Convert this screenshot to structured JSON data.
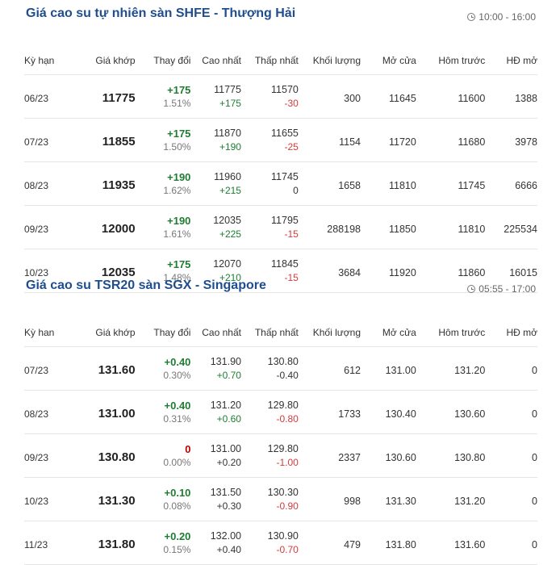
{
  "sections": [
    {
      "title": "Giá cao su tự nhiên sàn SHFE - Thượng Hải",
      "time": "10:00 - 16:00",
      "headers": [
        "Kỳ hạn",
        "Giá khớp",
        "Thay đổi",
        "Cao nhất",
        "Thấp nhất",
        "Khối lượng",
        "Mở cửa",
        "Hôm trước",
        "HĐ mở"
      ],
      "rows": [
        {
          "term": "06/23",
          "price": "11775",
          "change": "+175",
          "pct": "1.51%",
          "change_dir": "up",
          "high": "11775",
          "high_chg": "+175",
          "high_dir": "up",
          "low": "11570",
          "low_chg": "-30",
          "low_dir": "down",
          "volume": "300",
          "open": "11645",
          "prev": "11600",
          "oi": "1388"
        },
        {
          "term": "07/23",
          "price": "11855",
          "change": "+175",
          "pct": "1.50%",
          "change_dir": "up",
          "high": "11870",
          "high_chg": "+190",
          "high_dir": "up",
          "low": "11655",
          "low_chg": "-25",
          "low_dir": "down",
          "volume": "1154",
          "open": "11720",
          "prev": "11680",
          "oi": "3978"
        },
        {
          "term": "08/23",
          "price": "11935",
          "change": "+190",
          "pct": "1.62%",
          "change_dir": "up",
          "high": "11960",
          "high_chg": "+215",
          "high_dir": "up",
          "low": "11745",
          "low_chg": "0",
          "low_dir": "flat",
          "volume": "1658",
          "open": "11810",
          "prev": "11745",
          "oi": "6666"
        },
        {
          "term": "09/23",
          "price": "12000",
          "change": "+190",
          "pct": "1.61%",
          "change_dir": "up",
          "high": "12035",
          "high_chg": "+225",
          "high_dir": "up",
          "low": "11795",
          "low_chg": "-15",
          "low_dir": "down",
          "volume": "288198",
          "open": "11850",
          "prev": "11810",
          "oi": "225534"
        },
        {
          "term": "10/23",
          "price": "12035",
          "change": "+175",
          "pct": "1.48%",
          "change_dir": "up",
          "high": "12070",
          "high_chg": "+210",
          "high_dir": "up",
          "low": "11845",
          "low_chg": "-15",
          "low_dir": "down",
          "volume": "3684",
          "open": "11920",
          "prev": "11860",
          "oi": "16015"
        }
      ]
    },
    {
      "title": "Giá cao su TSR20 sàn SGX - Singapore",
      "time": "05:55 - 17:00",
      "headers": [
        "Kỳ han",
        "Giá khớp",
        "Thay đổi",
        "Cao nhất",
        "Thấp nhất",
        "Khối lượng",
        "Mở cửa",
        "Hôm trước",
        "HĐ mở"
      ],
      "rows": [
        {
          "term": "07/23",
          "price": "131.60",
          "change": "+0.40",
          "pct": "0.30%",
          "change_dir": "up",
          "high": "131.90",
          "high_chg": "+0.70",
          "high_dir": "up",
          "low": "130.80",
          "low_chg": "-0.40",
          "low_dir": "flat",
          "volume": "612",
          "open": "131.00",
          "prev": "131.20",
          "oi": "0"
        },
        {
          "term": "08/23",
          "price": "131.00",
          "change": "+0.40",
          "pct": "0.31%",
          "change_dir": "up",
          "high": "131.20",
          "high_chg": "+0.60",
          "high_dir": "up",
          "low": "129.80",
          "low_chg": "-0.80",
          "low_dir": "down",
          "volume": "1733",
          "open": "130.40",
          "prev": "130.60",
          "oi": "0"
        },
        {
          "term": "09/23",
          "price": "130.80",
          "change": "0",
          "pct": "0.00%",
          "change_dir": "ref",
          "high": "131.00",
          "high_chg": "+0.20",
          "high_dir": "flat",
          "low": "129.80",
          "low_chg": "-1.00",
          "low_dir": "down",
          "volume": "2337",
          "open": "130.60",
          "prev": "130.80",
          "oi": "0"
        },
        {
          "term": "10/23",
          "price": "131.30",
          "change": "+0.10",
          "pct": "0.08%",
          "change_dir": "up",
          "high": "131.50",
          "high_chg": "+0.30",
          "high_dir": "flat",
          "low": "130.30",
          "low_chg": "-0.90",
          "low_dir": "down",
          "volume": "998",
          "open": "131.30",
          "prev": "131.20",
          "oi": "0"
        },
        {
          "term": "11/23",
          "price": "131.80",
          "change": "+0.20",
          "pct": "0.15%",
          "change_dir": "up",
          "high": "132.00",
          "high_chg": "+0.40",
          "high_dir": "flat",
          "low": "130.90",
          "low_chg": "-0.70",
          "low_dir": "down",
          "volume": "479",
          "open": "131.80",
          "prev": "131.60",
          "oi": "0"
        }
      ]
    }
  ],
  "colors": {
    "title": "#1f4e8f",
    "up": "#1e7d32",
    "down": "#d63a3a",
    "ref": "#c00000"
  }
}
